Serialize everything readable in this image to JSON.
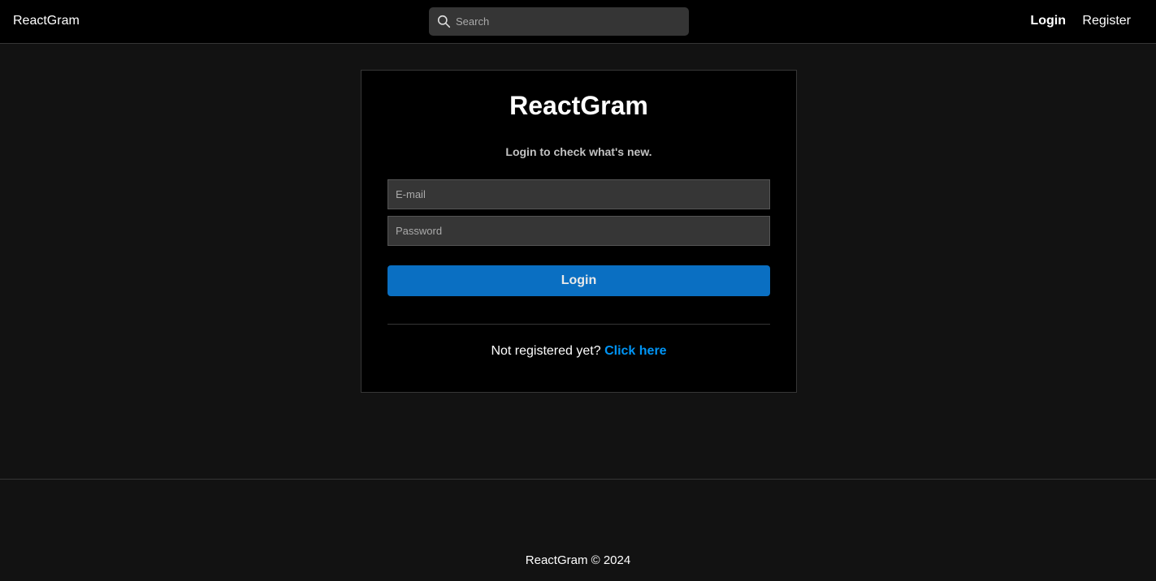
{
  "navbar": {
    "brand": "ReactGram",
    "search": {
      "placeholder": "Search",
      "icon": "search-icon"
    },
    "links": {
      "login": "Login",
      "register": "Register"
    }
  },
  "auth": {
    "title": "ReactGram",
    "subtitle": "Login to check what's new.",
    "email_placeholder": "E-mail",
    "password_placeholder": "Password",
    "submit_label": "Login",
    "register_prompt": "Not registered yet?",
    "register_link": "Click here"
  },
  "footer": {
    "text": "ReactGram © 2024"
  },
  "colors": {
    "background": "#121212",
    "navbar": "#000000",
    "card": "#000000",
    "input": "#363636",
    "primary_button": "#0a6fc2",
    "link": "#0095f6"
  }
}
